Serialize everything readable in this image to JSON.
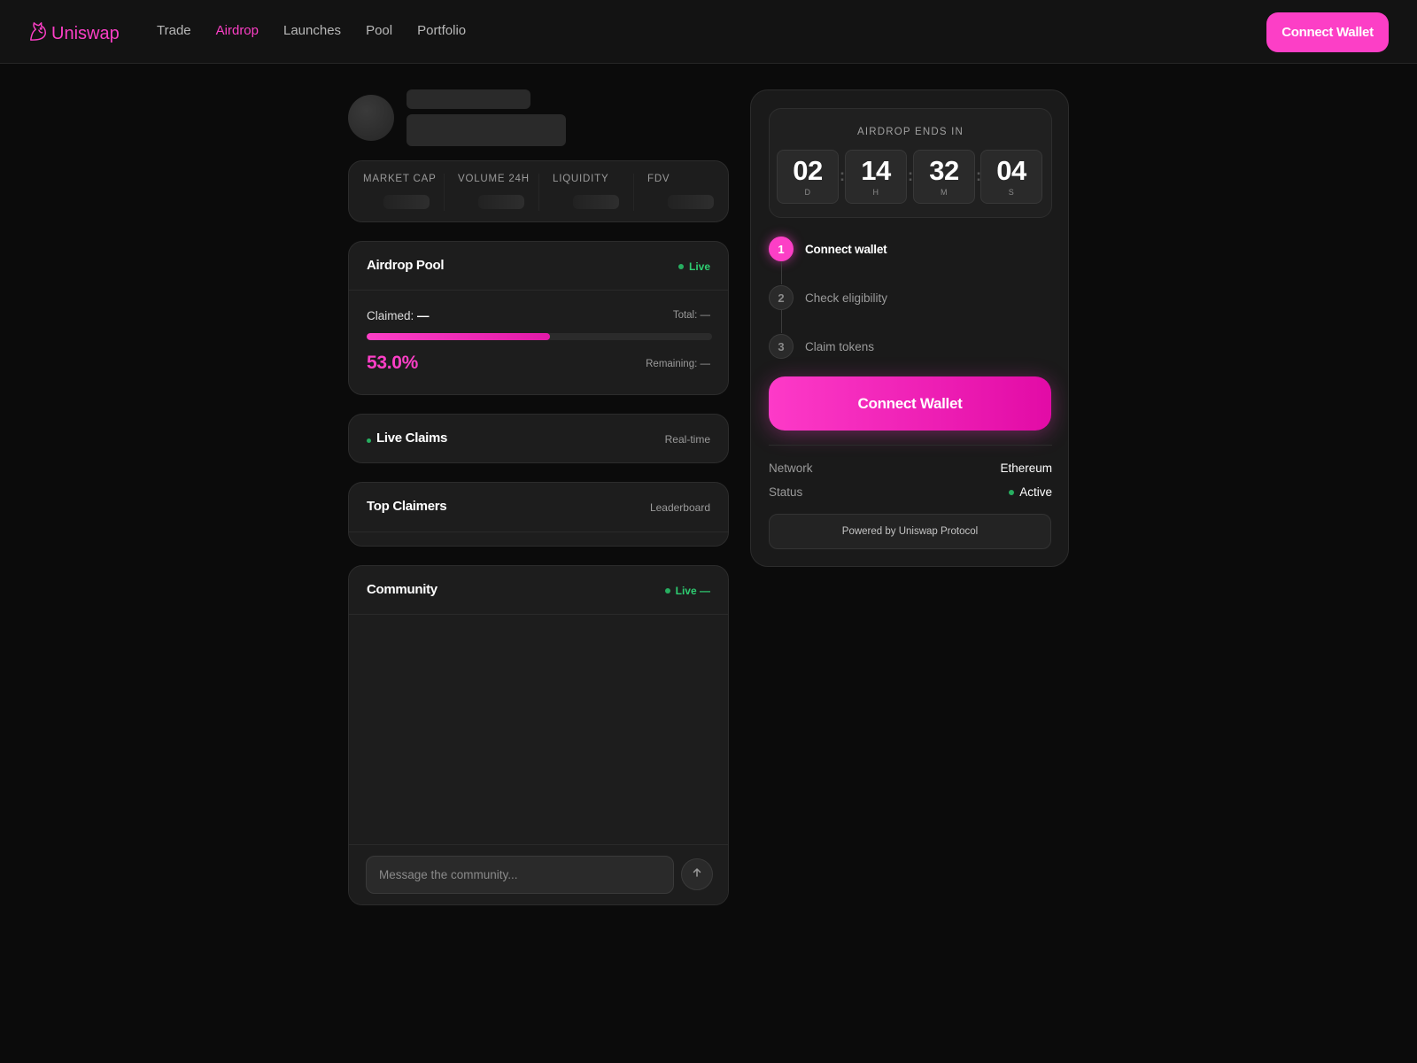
{
  "brand": {
    "name": "Uniswap",
    "logo_icon": "unicorn-icon",
    "accent": "#fc3fc6"
  },
  "nav": {
    "items": [
      {
        "label": "Trade",
        "active": false
      },
      {
        "label": "Airdrop",
        "active": true
      },
      {
        "label": "Launches",
        "active": false
      },
      {
        "label": "Pool",
        "active": false
      },
      {
        "label": "Portfolio",
        "active": false
      }
    ],
    "connect_label": "Connect Wallet"
  },
  "stats": {
    "labels": [
      "MARKET CAP",
      "VOLUME 24H",
      "LIQUIDITY",
      "FDV"
    ]
  },
  "airdrop_pool": {
    "title": "Airdrop Pool",
    "status": "Live",
    "claimed_label": "Claimed:",
    "claimed_value": "—",
    "total_label": "Total: —",
    "progress_fraction": 0.53,
    "percent_text": "53.0%",
    "remaining_label": "Remaining: —"
  },
  "live_claims": {
    "title": "Live Claims",
    "meta": "Real-time"
  },
  "top_claimers": {
    "title": "Top Claimers",
    "meta": "Leaderboard"
  },
  "community": {
    "title": "Community",
    "status": "Live —",
    "input_placeholder": "Message the community...",
    "send_icon": "arrow-up-icon"
  },
  "countdown": {
    "title": "AIRDROP ENDS IN",
    "units": [
      {
        "value": "02",
        "label": "D"
      },
      {
        "value": "14",
        "label": "H"
      },
      {
        "value": "32",
        "label": "M"
      },
      {
        "value": "04",
        "label": "S"
      }
    ]
  },
  "steps": [
    {
      "number": "1",
      "label": "Connect wallet",
      "active": true
    },
    {
      "number": "2",
      "label": "Check eligibility",
      "active": false
    },
    {
      "number": "3",
      "label": "Claim tokens",
      "active": false
    }
  ],
  "wallet": {
    "connect_label": "Connect Wallet",
    "network_label": "Network",
    "network_value": "Ethereum",
    "status_label": "Status",
    "status_value": "Active",
    "powered_by": "Powered by Uniswap Protocol"
  }
}
